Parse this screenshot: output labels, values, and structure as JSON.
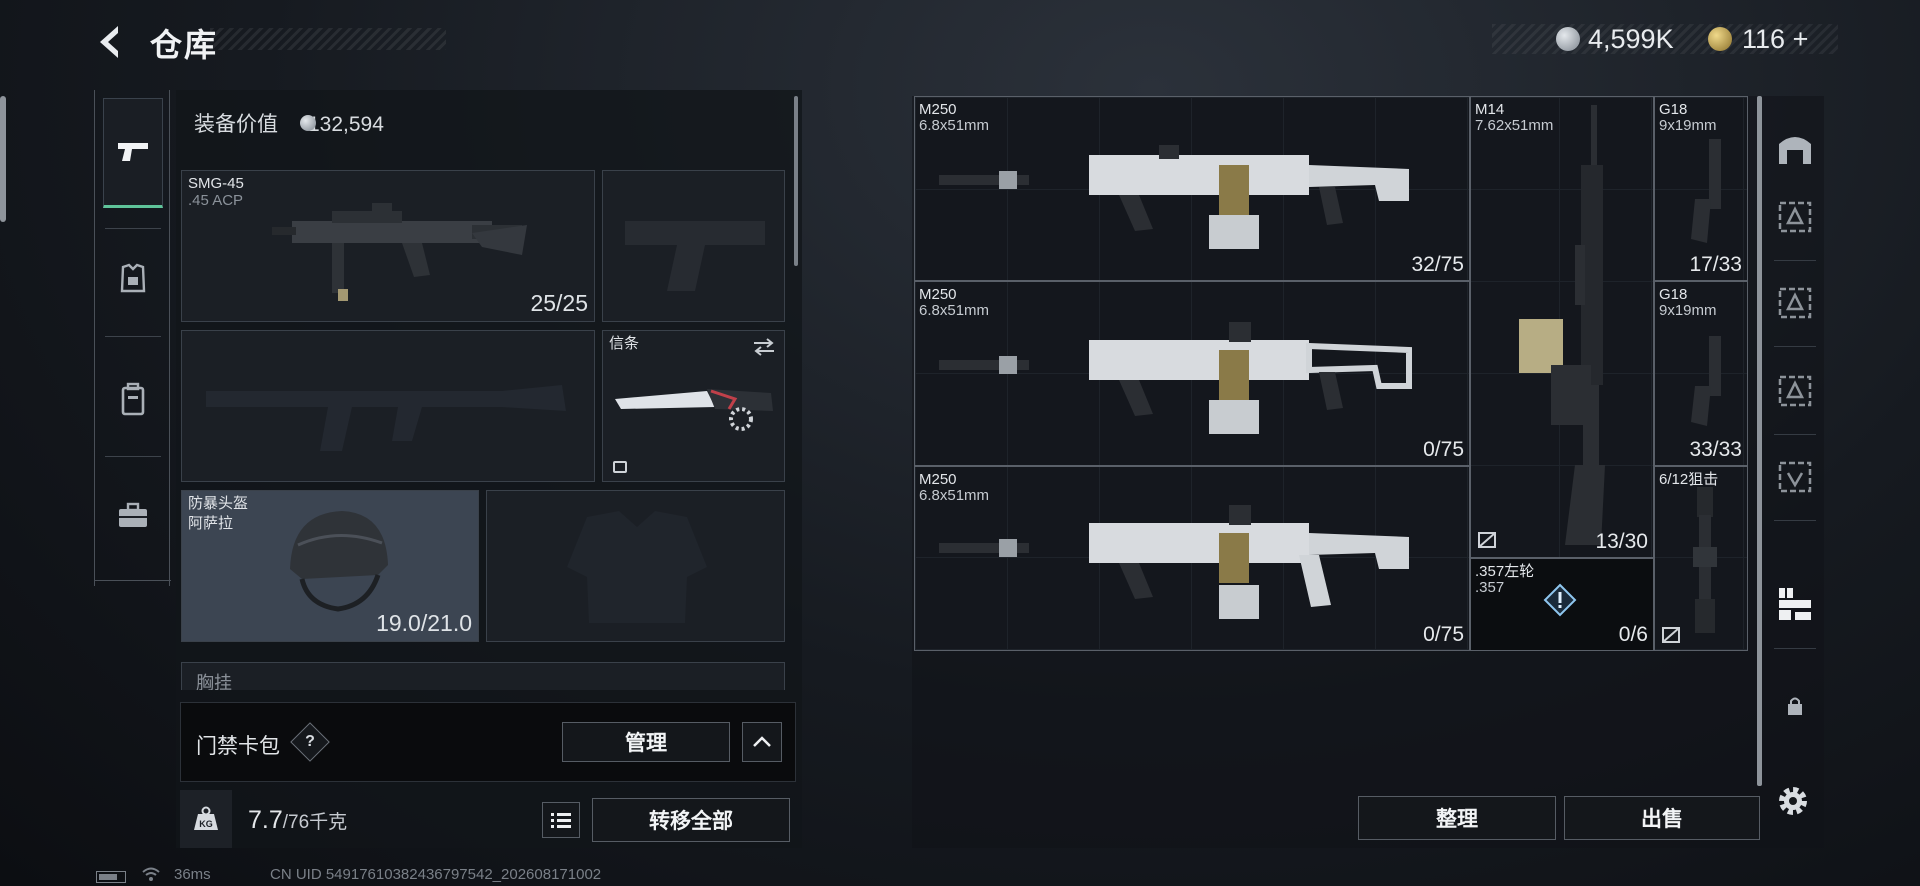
{
  "header": {
    "title": "仓库",
    "silver": "4,599K",
    "gold": "116",
    "gold_plus": "+"
  },
  "equipment": {
    "value_label": "装备价值",
    "value": "132,594",
    "slots": [
      {
        "name": "SMG-45",
        "ammo": ".45 ACP",
        "count": "25/25"
      },
      {
        "name": "信条"
      },
      {
        "name": "防暴头盔",
        "sub": "阿萨拉",
        "count": "19.0/21.0"
      }
    ],
    "chest_label": "胸挂"
  },
  "keycard": {
    "label": "门禁卡包",
    "help": "?",
    "manage": "管理"
  },
  "weight": {
    "icon_text": "KG",
    "current": "7.7",
    "max": "/76千克",
    "transfer_all": "转移全部"
  },
  "storage": {
    "items": [
      {
        "name": "M250",
        "caliber": "6.8x51mm",
        "count": "32/75"
      },
      {
        "name": "M250",
        "caliber": "6.8x51mm",
        "count": "0/75"
      },
      {
        "name": "M250",
        "caliber": "6.8x51mm",
        "count": "0/75"
      },
      {
        "name": "M14",
        "caliber": "7.62x51mm",
        "count": "13/30"
      },
      {
        "name": "G18",
        "caliber": "9x19mm",
        "count": "17/33"
      },
      {
        "name": "G18",
        "caliber": "9x19mm",
        "count": "33/33"
      },
      {
        "name": "6/12狙击",
        "caliber": ""
      },
      {
        "name": ".357左轮",
        "caliber": ".357",
        "count": "0/6"
      }
    ],
    "sort": "整理",
    "sell": "出售"
  },
  "status": {
    "ping": "36ms",
    "uid": "CN UID 5491761038243679754​2_202608171002"
  }
}
